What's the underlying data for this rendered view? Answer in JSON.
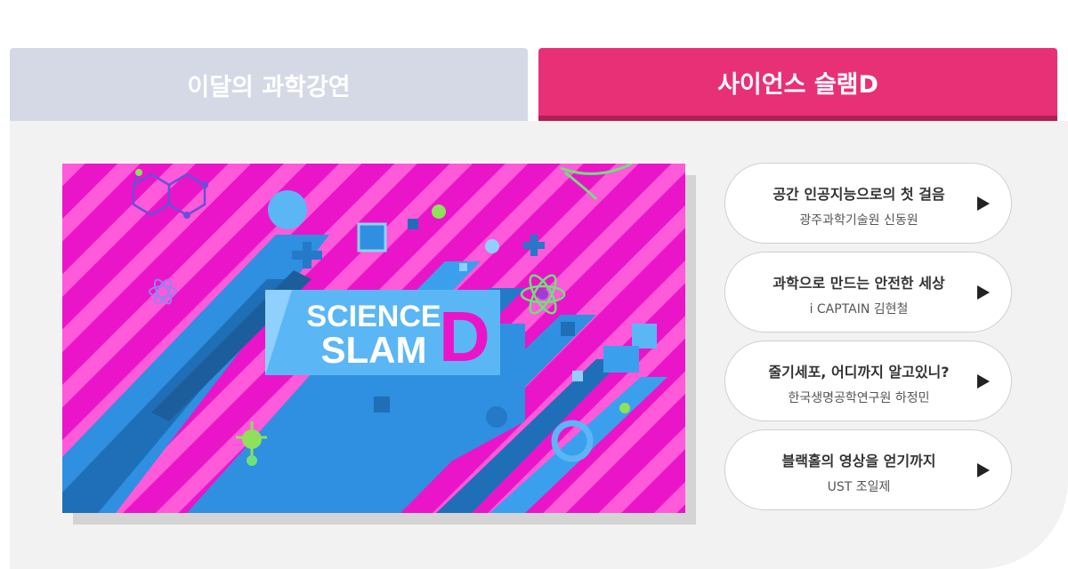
{
  "tabs": {
    "monthly": "이달의 과학강연",
    "slam": "사이언스 슬램D"
  },
  "banner": {
    "line1": "SCIENCE",
    "line2": "SLAM",
    "letter": "D"
  },
  "colors": {
    "tab_inactive": "#d5d9e6",
    "tab_active": "#e83076",
    "banner_magenta": "#ea15c8",
    "banner_blue": "#2f8fe0"
  },
  "talks": [
    {
      "title": "공간 인공지능으로의 첫 걸음",
      "speaker": "광주과학기술원 신동원"
    },
    {
      "title": "과학으로 만드는 안전한 세상",
      "speaker": "i CAPTAIN 김현철"
    },
    {
      "title": "줄기세포, 어디까지 알고있니?",
      "speaker": "한국생명공학연구원 하정민"
    },
    {
      "title": "블랙홀의 영상을 얻기까지",
      "speaker": "UST 조일제"
    }
  ]
}
